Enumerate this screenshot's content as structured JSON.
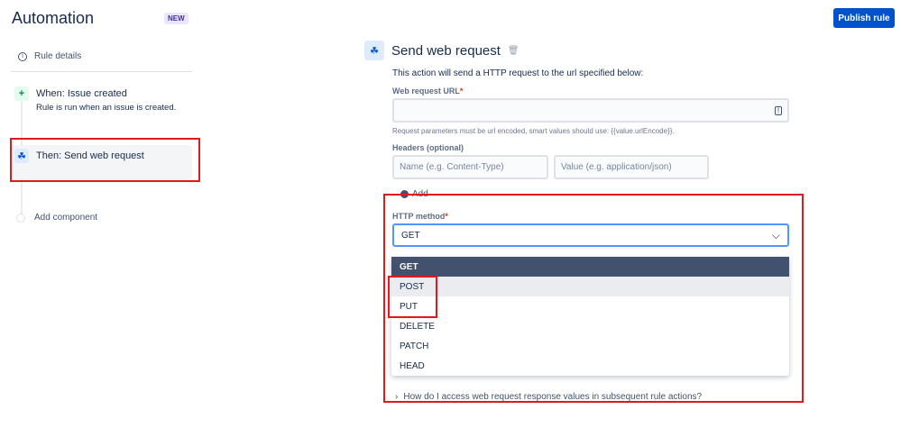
{
  "header": {
    "title": "Automation",
    "badge": "NEW",
    "publish_label": "Publish rule"
  },
  "sidebar": {
    "rule_details": "Rule details",
    "trigger": {
      "title": "When: Issue created",
      "desc": "Rule is run when an issue is created."
    },
    "action": {
      "title": "Then: Send web request"
    },
    "add_component": "Add component"
  },
  "main": {
    "title": "Send web request",
    "description": "This action will send a HTTP request to the url specified below:",
    "url_label": "Web request URL",
    "url_value": "",
    "url_help": "Request parameters must be url encoded, smart values should use: {{value.urlEncode}}.",
    "headers_label": "Headers (optional)",
    "header_name_placeholder": "Name (e.g. Content-Type)",
    "header_value_placeholder": "Value (e.g. application/json)",
    "add_label": "Add",
    "method_label": "HTTP method",
    "method_value": "GET",
    "method_options": [
      "GET",
      "POST",
      "PUT",
      "DELETE",
      "PATCH",
      "HEAD"
    ],
    "help_link": "How do I access web request response values in subsequent rule actions?"
  },
  "colors": {
    "primary": "#0052cc",
    "highlight": "#e0191e"
  }
}
